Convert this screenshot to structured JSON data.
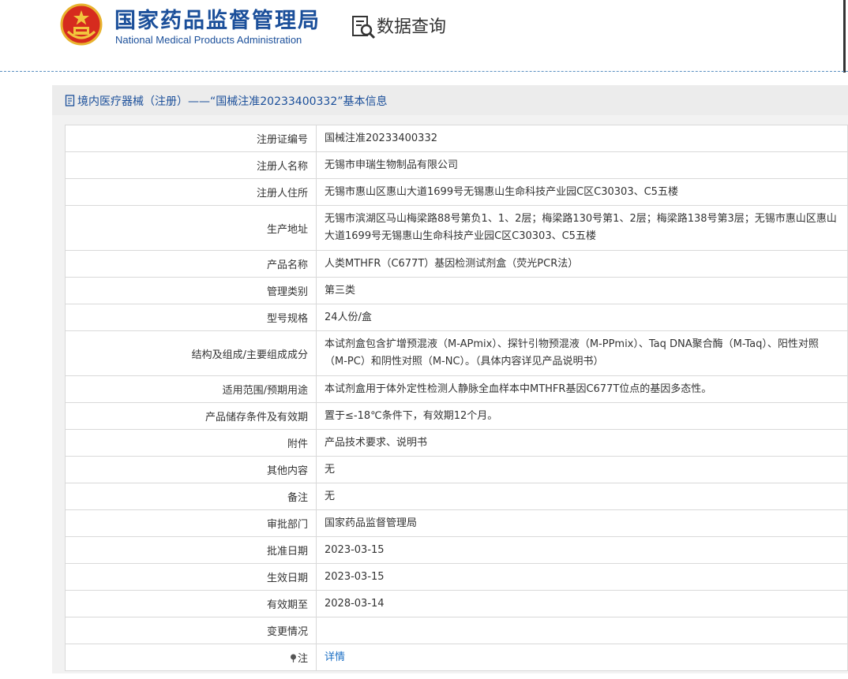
{
  "header": {
    "agency_cn": "国家药品监督管理局",
    "agency_en": "National Medical Products Administration",
    "query_title": "数据查询",
    "brand_color": "#1b4f9a"
  },
  "panel": {
    "title": "境内医疗器械（注册）——“国械注准20233400332”基本信息"
  },
  "rows": [
    {
      "label": "注册证编号",
      "value": "国械注准20233400332"
    },
    {
      "label": "注册人名称",
      "value": "无锡市申瑞生物制品有限公司"
    },
    {
      "label": "注册人住所",
      "value": "无锡市惠山区惠山大道1699号无锡惠山生命科技产业园C区C30303、C5五楼"
    },
    {
      "label": "生产地址",
      "value": "无锡市滨湖区马山梅梁路88号第负1、1、2层；梅梁路130号第1、2层；梅梁路138号第3层；无锡市惠山区惠山大道1699号无锡惠山生命科技产业园C区C30303、C5五楼"
    },
    {
      "label": "产品名称",
      "value": "人类MTHFR（C677T）基因检测试剂盒（荧光PCR法）"
    },
    {
      "label": "管理类别",
      "value": "第三类"
    },
    {
      "label": "型号规格",
      "value": "24人份/盒"
    },
    {
      "label": "结构及组成/主要组成成分",
      "value": "本试剂盒包含扩增预混液（M-APmix）、探针引物预混液（M-PPmix）、Taq DNA聚合酶（M-Taq）、阳性对照（M-PC）和阴性对照（M-NC）。（具体内容详见产品说明书）"
    },
    {
      "label": "适用范围/预期用途",
      "value": "本试剂盒用于体外定性检测人静脉全血样本中MTHFR基因C677T位点的基因多态性。"
    },
    {
      "label": "产品储存条件及有效期",
      "value": "置于≤-18℃条件下，有效期12个月。"
    },
    {
      "label": "附件",
      "value": "产品技术要求、说明书"
    },
    {
      "label": "其他内容",
      "value": "无"
    },
    {
      "label": "备注",
      "value": "无"
    },
    {
      "label": "审批部门",
      "value": "国家药品监督管理局"
    },
    {
      "label": "批准日期",
      "value": "2023-03-15"
    },
    {
      "label": "生效日期",
      "value": "2023-03-15"
    },
    {
      "label": "有效期至",
      "value": "2028-03-14"
    },
    {
      "label": "变更情况",
      "value": ""
    },
    {
      "label": "注",
      "value": "详情"
    }
  ],
  "icons": {
    "emblem": "national-emblem-icon",
    "query": "document-search-icon",
    "title": "document-icon",
    "note": "pin-icon"
  }
}
